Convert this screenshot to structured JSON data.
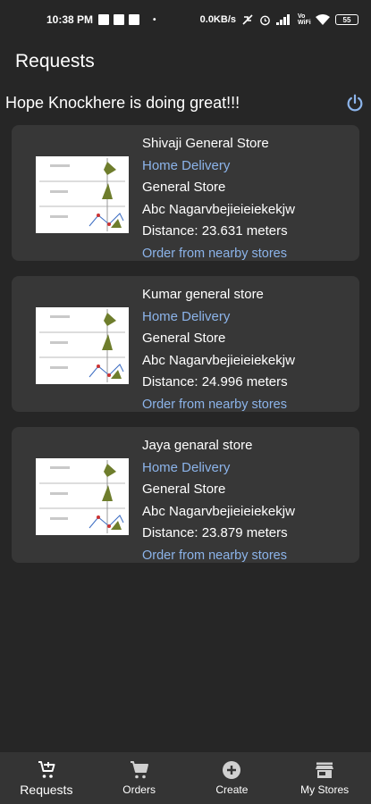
{
  "status_bar": {
    "time": "10:38 PM",
    "network_speed": "0.0KB/s",
    "volte": "Vo\nWiFi",
    "battery": "55"
  },
  "app_bar": {
    "title": "Requests"
  },
  "greeting": "Hope Knockhere is doing great!!!",
  "stores": [
    {
      "name": "Shivaji General Store",
      "delivery": "Home Delivery",
      "category": "General Store",
      "address": "Abc Nagarvbejieieiekekjw",
      "distance": "Distance: 23.631  meters",
      "link": "Order from nearby stores"
    },
    {
      "name": "Kumar general store",
      "delivery": "Home Delivery",
      "category": "General Store",
      "address": "Abc Nagarvbejieieiekekjw",
      "distance": "Distance: 24.996  meters",
      "link": "Order from nearby stores"
    },
    {
      "name": "Jaya genaral store",
      "delivery": "Home Delivery",
      "category": "General Store",
      "address": "Abc Nagarvbejieieiekekjw",
      "distance": "Distance: 23.879  meters",
      "link": "Order from nearby stores"
    }
  ],
  "nav": [
    {
      "label": "Requests",
      "icon": "cart-plus-icon",
      "active": true
    },
    {
      "label": "Orders",
      "icon": "cart-icon"
    },
    {
      "label": "Create",
      "icon": "add-circle-icon"
    },
    {
      "label": "My Stores",
      "icon": "store-icon"
    }
  ],
  "colors": {
    "background": "#262626",
    "card": "#373737",
    "link": "#8cb4ea",
    "power_icon": "#8cb4ea",
    "navbar": "#343434"
  }
}
